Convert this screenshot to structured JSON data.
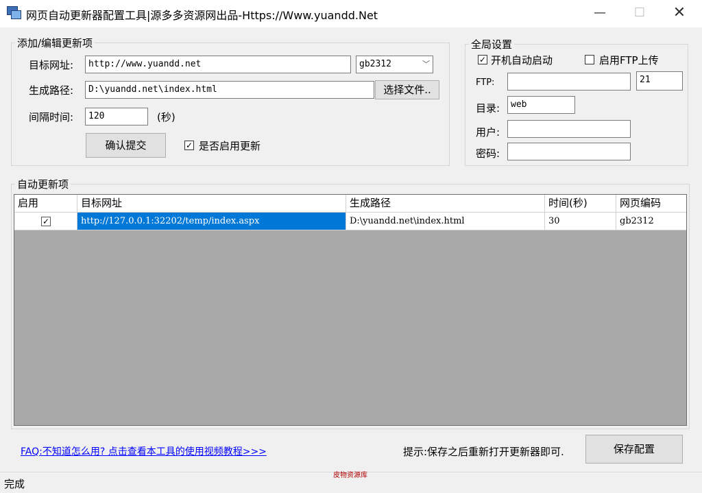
{
  "window": {
    "title": "网页自动更新器配置工具|源多多资源网出品-Https://Www.yuandd.Net",
    "min_glyph": "—",
    "max_glyph": "☐",
    "close_glyph": "✕"
  },
  "edit_group": {
    "legend": "添加/编辑更新项",
    "url_label": "目标网址:",
    "url_value": "http://www.yuandd.net",
    "encoding_value": "gb2312",
    "path_label": "生成路径:",
    "path_value": "D:\\yuandd.net\\index.html",
    "browse_label": "选择文件..",
    "interval_label": "间隔时间:",
    "interval_value": "120",
    "interval_unit": "(秒)",
    "submit_label": "确认提交",
    "enable_label": "是否启用更新",
    "enable_checked": true
  },
  "global_group": {
    "legend": "全局设置",
    "autostart_label": "开机自动启动",
    "autostart_checked": true,
    "ftp_upload_label": "启用FTP上传",
    "ftp_upload_checked": false,
    "ftp_label": "FTP:",
    "ftp_value": "",
    "port_value": "21",
    "dir_label": "目录:",
    "dir_value": "web",
    "user_label": "用户:",
    "user_value": "",
    "password_label": "密码:",
    "password_value": ""
  },
  "list_group": {
    "legend": "自动更新项",
    "columns": [
      "启用",
      "目标网址",
      "生成路径",
      "时间(秒)",
      "网页编码"
    ],
    "rows": [
      {
        "enabled": true,
        "url": "http://127.0.0.1:32202/temp/index.aspx",
        "path": "D:\\yuandd.net\\index.html",
        "interval": "30",
        "encoding": "gb2312"
      }
    ]
  },
  "footer": {
    "faq_link": "FAQ:不知道怎么用? 点击查看本工具的使用视频教程>>>",
    "tip": "提示:保存之后重新打开更新器即可.",
    "save_label": "保存配置",
    "status": "完成",
    "watermark": "皮物资源库"
  },
  "colors": {
    "selection": "#0078d7",
    "grid_background": "#a9a9a9",
    "link": "#0000ff"
  }
}
